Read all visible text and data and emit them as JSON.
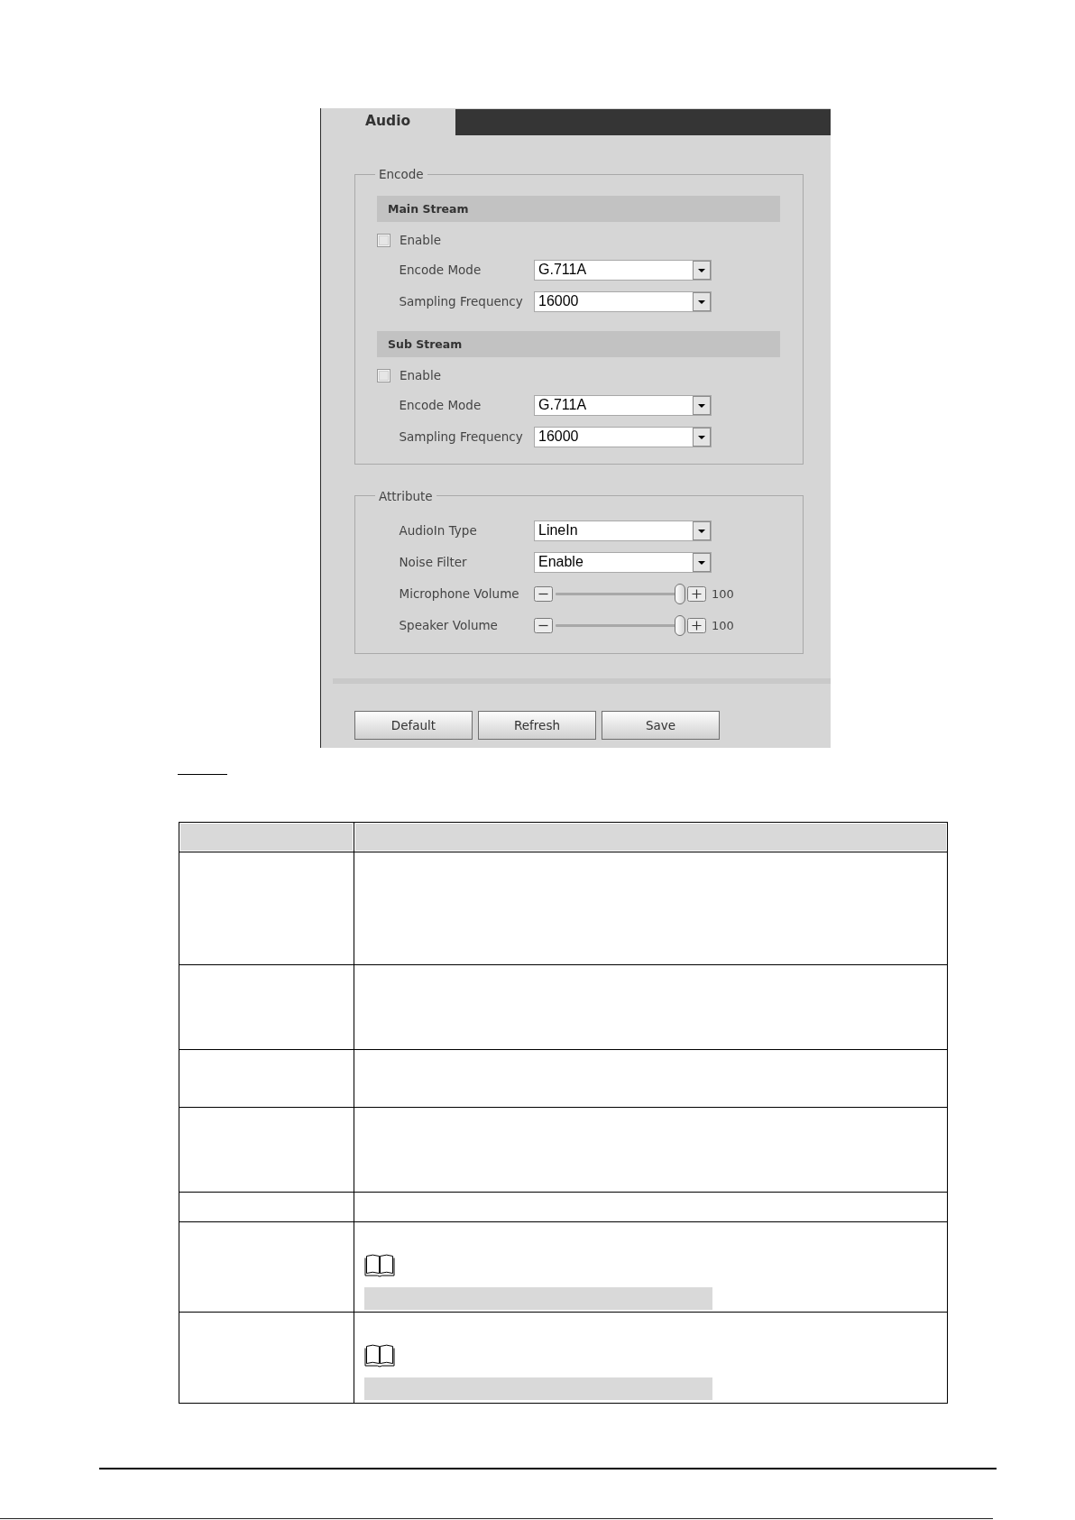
{
  "panel": {
    "tab": "Audio",
    "encode": {
      "legend": "Encode",
      "streams": [
        {
          "title": "Main Stream",
          "enable": {
            "label": "Enable",
            "checked": false
          },
          "fields": [
            {
              "label": "Encode Mode",
              "value": "G.711A"
            },
            {
              "label": "Sampling Frequency",
              "value": "16000"
            }
          ]
        },
        {
          "title": "Sub Stream",
          "enable": {
            "label": "Enable",
            "checked": false
          },
          "fields": [
            {
              "label": "Encode Mode",
              "value": "G.711A"
            },
            {
              "label": "Sampling Frequency",
              "value": "16000"
            }
          ]
        }
      ]
    },
    "attribute": {
      "legend": "Attribute",
      "fields": [
        {
          "kind": "select",
          "label": "AudioIn Type",
          "value": "LineIn"
        },
        {
          "kind": "select",
          "label": "Noise Filter",
          "value": "Enable"
        },
        {
          "kind": "slider",
          "label": "Microphone Volume",
          "level": 1,
          "reading": "100"
        },
        {
          "kind": "slider",
          "label": "Speaker Volume",
          "level": 1,
          "reading": "100"
        }
      ]
    },
    "buttons": [
      "Default",
      "Refresh",
      "Save"
    ]
  },
  "table": {
    "rows": [
      {
        "kind": "header"
      },
      {
        "kind": "blank"
      },
      {
        "kind": "blank"
      },
      {
        "kind": "blank"
      },
      {
        "kind": "blank"
      },
      {
        "kind": "blank"
      },
      {
        "kind": "note"
      },
      {
        "kind": "note"
      }
    ]
  }
}
